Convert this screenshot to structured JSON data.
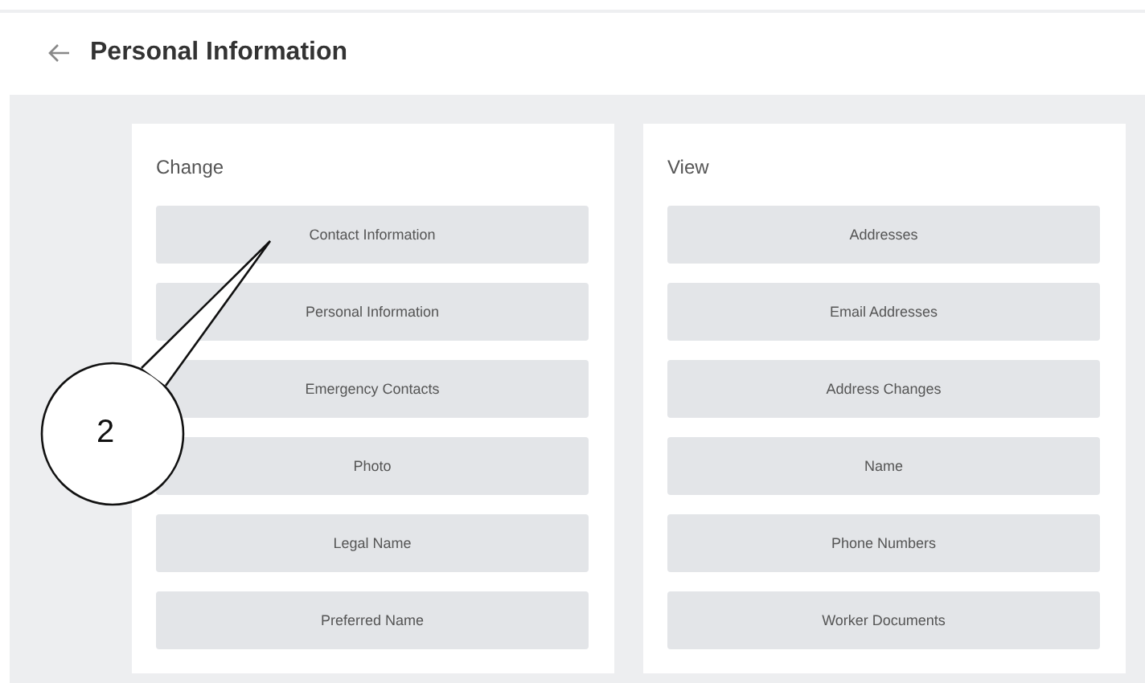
{
  "page": {
    "title": "Personal Information"
  },
  "sections": [
    {
      "title": "Change",
      "items": [
        "Contact Information",
        "Personal Information",
        "Emergency Contacts",
        "Photo",
        "Legal Name",
        "Preferred Name"
      ]
    },
    {
      "title": "View",
      "items": [
        "Addresses",
        "Email Addresses",
        "Address Changes",
        "Name",
        "Phone Numbers",
        "Worker Documents"
      ]
    }
  ],
  "callout": {
    "number": "2"
  }
}
